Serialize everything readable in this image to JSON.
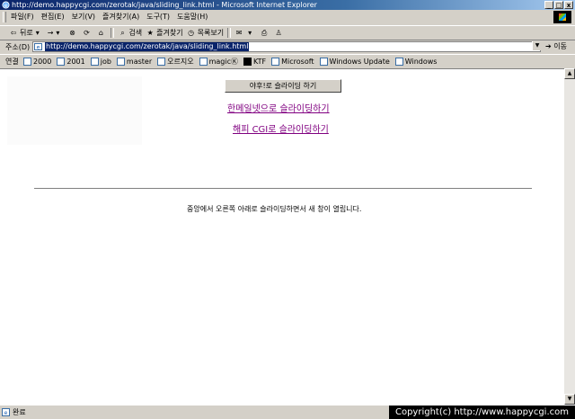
{
  "window": {
    "title": "http://demo.happycgi.com/zerotak/java/sliding_link.html - Microsoft Internet Explorer",
    "minimize": "_",
    "maximize": "□",
    "close": "x"
  },
  "menu": [
    "파일(F)",
    "편집(E)",
    "보기(V)",
    "즐겨찾기(A)",
    "도구(T)",
    "도움말(H)"
  ],
  "toolbar": {
    "back": "뒤로",
    "forward": "→",
    "search": "검색",
    "favorites": "즐겨찾기",
    "history": "목록보기"
  },
  "address": {
    "label": "주소(D)",
    "url": "http://demo.happycgi.com/zerotak/java/sliding_link.html",
    "go": "이동"
  },
  "links": {
    "label": "연결",
    "items": [
      "2000",
      "2001",
      "job",
      "master",
      "오르지오",
      "magicⓀ",
      "KTF",
      "Microsoft",
      "Windows Update",
      "Windows"
    ]
  },
  "page": {
    "slide_button": "야후!로 슬라이딩 하기",
    "link1": "한메일넷으로 슬라이딩하기",
    "link2": "해피 CGI로 슬라이딩하기",
    "description": "중앙에서 오른쪽 아래로 슬라이딩하면서 새 창이 열립니다."
  },
  "status": {
    "text": "완료",
    "copyright": "Copyright(c) http://www.happycgi.com"
  },
  "colors": {
    "title_bar": "#0a246a",
    "visited_link": "#800080",
    "url_highlight": "#0a246a"
  }
}
